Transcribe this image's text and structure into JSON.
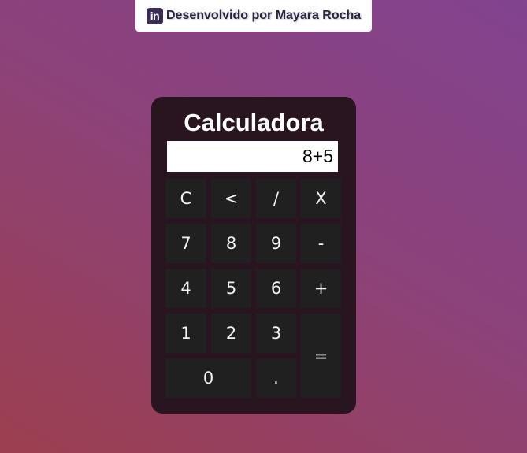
{
  "credit": {
    "icon": "linkedin-icon",
    "text": "Desenvolvido por Mayara Rocha"
  },
  "calculator": {
    "title": "Calculadora",
    "display_value": "8+5",
    "keys": {
      "clear": "C",
      "backspace": "<",
      "divide": "/",
      "multiply": "X",
      "seven": "7",
      "eight": "8",
      "nine": "9",
      "minus": "-",
      "four": "4",
      "five": "5",
      "six": "6",
      "plus": "+",
      "one": "1",
      "two": "2",
      "three": "3",
      "equals": "=",
      "zero": "0",
      "decimal": "."
    }
  }
}
